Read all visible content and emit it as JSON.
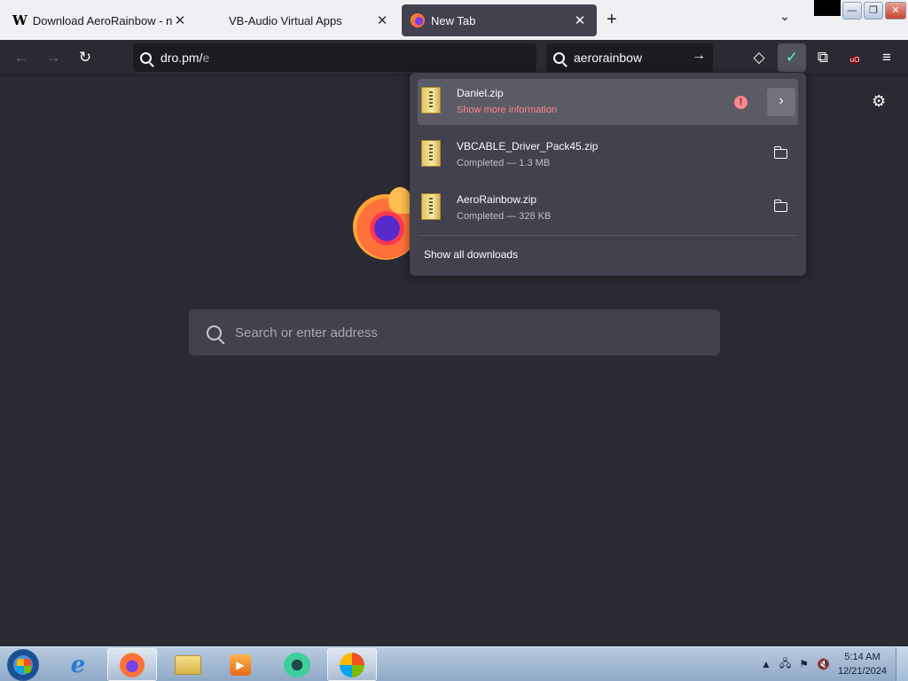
{
  "tabs": [
    {
      "title": "Download AeroRainbow - nice",
      "favicon": "wikipedia-w"
    },
    {
      "title": "VB-Audio Virtual Apps",
      "favicon": "none"
    },
    {
      "title": "New Tab",
      "favicon": "firefox"
    }
  ],
  "tabstrip": {
    "new_tab": "+",
    "list_all_tabs": "⌄"
  },
  "window_controls": {
    "minimize": "—",
    "restore": "❐",
    "close": "✕"
  },
  "nav": {
    "back": "←",
    "forward": "→",
    "reload": "↻",
    "url_value": "dro.pm/",
    "url_trailing": "e",
    "search_value": "aerorainbow",
    "search_go": "→",
    "pocket": "◇",
    "downloads": "✓",
    "extensions": "⧉",
    "ublock": "uO",
    "menu": "≡"
  },
  "newtab": {
    "search_placeholder": "Search or enter address",
    "settings": "⚙"
  },
  "downloads": {
    "items": [
      {
        "name": "Daniel.zip",
        "status": "Show more information",
        "state": "warning",
        "warn_glyph": "!",
        "action": "›"
      },
      {
        "name": "VBCABLE_Driver_Pack45.zip",
        "status": "Completed — 1.3 MB",
        "state": "completed"
      },
      {
        "name": "AeroRainbow.zip",
        "status": "Completed — 328 KB",
        "state": "completed"
      }
    ],
    "show_all": "Show all downloads"
  },
  "taskbar": {
    "ie": "e",
    "media": "▶",
    "tray": {
      "arrow": "▲",
      "network": "🖧",
      "flag": "⚑",
      "volume": "🔇"
    },
    "time": "5:14 AM",
    "date": "12/21/2024"
  },
  "colors": {
    "toolbar": "#2b2a33",
    "panel": "#42414d",
    "warning": "#ff848b",
    "tabstrip": "#f0f0f4"
  }
}
